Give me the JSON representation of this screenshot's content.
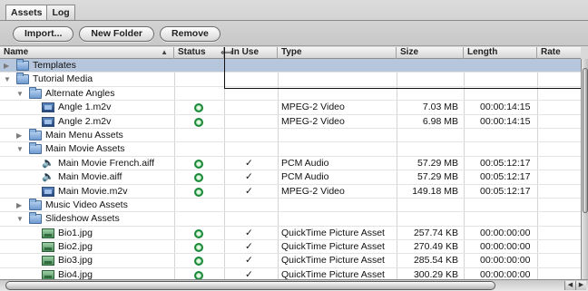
{
  "tabs": [
    {
      "label": "Assets",
      "active": true
    },
    {
      "label": "Log",
      "active": false
    }
  ],
  "toolbar": {
    "import_label": "Import...",
    "new_folder_label": "New Folder",
    "remove_label": "Remove"
  },
  "columns": {
    "name": "Name",
    "status": "Status",
    "in_use": "In Use",
    "type": "Type",
    "size": "Size",
    "length": "Length",
    "rate": "Rate"
  },
  "rows": [
    {
      "name": "Templates",
      "icon": "folder-icon",
      "indent": 0,
      "expanded": false,
      "selected": true,
      "status": "",
      "in_use": "",
      "type": "",
      "size": "",
      "length": ""
    },
    {
      "name": "Tutorial Media",
      "icon": "folder-icon",
      "indent": 0,
      "expanded": true,
      "selected": false,
      "status": "",
      "in_use": "",
      "type": "",
      "size": "",
      "length": ""
    },
    {
      "name": "Alternate Angles",
      "icon": "folder-icon",
      "indent": 1,
      "expanded": true,
      "selected": false,
      "status": "",
      "in_use": "",
      "type": "",
      "size": "",
      "length": ""
    },
    {
      "name": "Angle 1.m2v",
      "icon": "video-file-icon",
      "indent": 2,
      "expanded": null,
      "selected": false,
      "status": "ok",
      "in_use": "",
      "type": "MPEG-2 Video",
      "size": "7.03 MB",
      "length": "00:00:14:15"
    },
    {
      "name": "Angle 2.m2v",
      "icon": "video-file-icon",
      "indent": 2,
      "expanded": null,
      "selected": false,
      "status": "ok",
      "in_use": "",
      "type": "MPEG-2 Video",
      "size": "6.98 MB",
      "length": "00:00:14:15"
    },
    {
      "name": "Main Menu Assets",
      "icon": "folder-icon",
      "indent": 1,
      "expanded": false,
      "selected": false,
      "status": "",
      "in_use": "",
      "type": "",
      "size": "",
      "length": ""
    },
    {
      "name": "Main Movie Assets",
      "icon": "folder-icon",
      "indent": 1,
      "expanded": true,
      "selected": false,
      "status": "",
      "in_use": "",
      "type": "",
      "size": "",
      "length": ""
    },
    {
      "name": "Main Movie French.aiff",
      "icon": "audio-file-icon",
      "indent": 2,
      "expanded": null,
      "selected": false,
      "status": "ok",
      "in_use": "✓",
      "type": "PCM Audio",
      "size": "57.29 MB",
      "length": "00:05:12:17"
    },
    {
      "name": "Main Movie.aiff",
      "icon": "audio-file-icon",
      "indent": 2,
      "expanded": null,
      "selected": false,
      "status": "ok",
      "in_use": "✓",
      "type": "PCM Audio",
      "size": "57.29 MB",
      "length": "00:05:12:17"
    },
    {
      "name": "Main Movie.m2v",
      "icon": "video-file-icon",
      "indent": 2,
      "expanded": null,
      "selected": false,
      "status": "ok",
      "in_use": "✓",
      "type": "MPEG-2 Video",
      "size": "149.18 MB",
      "length": "00:05:12:17"
    },
    {
      "name": "Music Video Assets",
      "icon": "folder-icon",
      "indent": 1,
      "expanded": false,
      "selected": false,
      "status": "",
      "in_use": "",
      "type": "",
      "size": "",
      "length": ""
    },
    {
      "name": "Slideshow Assets",
      "icon": "folder-icon",
      "indent": 1,
      "expanded": true,
      "selected": false,
      "status": "",
      "in_use": "",
      "type": "",
      "size": "",
      "length": ""
    },
    {
      "name": "Bio1.jpg",
      "icon": "image-file-icon",
      "indent": 2,
      "expanded": null,
      "selected": false,
      "status": "ok",
      "in_use": "✓",
      "type": "QuickTime Picture Asset",
      "size": "257.74 KB",
      "length": "00:00:00:00"
    },
    {
      "name": "Bio2.jpg",
      "icon": "image-file-icon",
      "indent": 2,
      "expanded": null,
      "selected": false,
      "status": "ok",
      "in_use": "✓",
      "type": "QuickTime Picture Asset",
      "size": "270.49 KB",
      "length": "00:00:00:00"
    },
    {
      "name": "Bio3.jpg",
      "icon": "image-file-icon",
      "indent": 2,
      "expanded": null,
      "selected": false,
      "status": "ok",
      "in_use": "✓",
      "type": "QuickTime Picture Asset",
      "size": "285.54 KB",
      "length": "00:00:00:00"
    },
    {
      "name": "Bio4.jpg",
      "icon": "image-file-icon",
      "indent": 2,
      "expanded": null,
      "selected": false,
      "status": "ok",
      "in_use": "✓",
      "type": "QuickTime Picture Asset",
      "size": "300.29 KB",
      "length": "00:00:00:00"
    }
  ]
}
